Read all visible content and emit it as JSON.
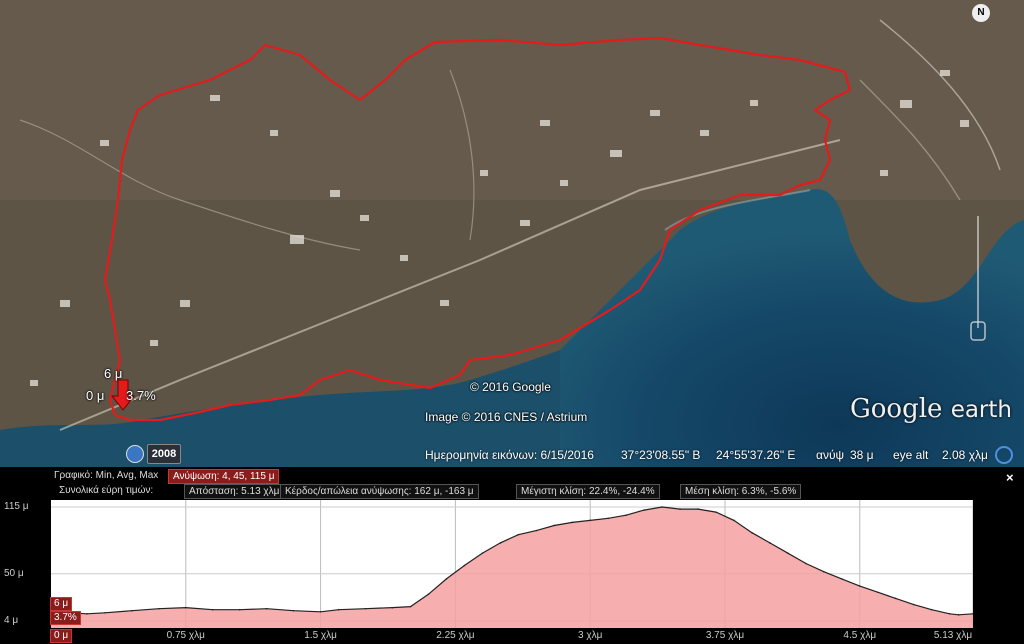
{
  "map": {
    "copyright_google": "© 2016 Google",
    "image_credit": "Image © 2016 CNES / Astrium",
    "brand_google": "Google",
    "brand_earth": "earth",
    "north_label": "N",
    "year": "2008",
    "cursor_elevation": "6 μ",
    "cursor_distance": "0 μ",
    "cursor_slope": "3.7%",
    "route_color": "#e41b1b"
  },
  "status": {
    "imagery_date": "Ημερομηνία εικόνων: 6/15/2016",
    "latitude": "37°23'08.55\" B",
    "longitude": "24°55'37.26\" E",
    "elev_label": "ανύψ",
    "elevation": "38 μ",
    "eye_alt_label": "eye alt",
    "eye_alt": "2.08 χλμ"
  },
  "profile": {
    "row1_label": "Γραφικό: Min, Avg, Max",
    "row1_value": "Ανύψωση: 4, 45, 115 μ",
    "row2_label": "Συνολικά εύρη τιμών:",
    "distance": "Απόσταση: 5.13 χλμ",
    "gain_loss": "Κέρδος/απώλεια ανύψωσης: 162 μ, -163 μ",
    "max_slope": "Μέγιστη κλίση: 22.4%, -24.4%",
    "avg_slope": "Μέση κλίση: 6.3%, -5.6%",
    "close": "×",
    "marker_elev": "6 μ",
    "marker_slope": "3.7%",
    "marker_dist": "0 μ"
  },
  "chart_data": {
    "type": "area",
    "title": "",
    "xlabel": "",
    "ylabel": "",
    "xlim": [
      0,
      5.13
    ],
    "ylim": [
      4,
      115
    ],
    "y_tick_labels": [
      "115 μ",
      "50 μ",
      "4 μ"
    ],
    "y_ticks": [
      115,
      50,
      4
    ],
    "x_tick_labels": [
      "0 μ",
      "0.75 χλμ",
      "1.5 χλμ",
      "2.25 χλμ",
      "3 χλμ",
      "3.75 χλμ",
      "4.5 χλμ",
      "5.13 χλμ"
    ],
    "x_ticks": [
      0,
      0.75,
      1.5,
      2.25,
      3,
      3.75,
      4.5,
      5.13
    ],
    "grid": true,
    "fill_color": "#f4a0a0",
    "line_color": "#222222",
    "series": [
      {
        "x": [
          0,
          0.1,
          0.2,
          0.3,
          0.45,
          0.6,
          0.75,
          0.9,
          1.05,
          1.2,
          1.35,
          1.5,
          1.6,
          1.75,
          1.9,
          2.0,
          2.1,
          2.2,
          2.3,
          2.4,
          2.5,
          2.6,
          2.7,
          2.8,
          2.9,
          3.0,
          3.1,
          3.2,
          3.3,
          3.4,
          3.5,
          3.6,
          3.7,
          3.8,
          3.9,
          4.0,
          4.1,
          4.2,
          4.3,
          4.4,
          4.5,
          4.6,
          4.7,
          4.8,
          4.9,
          5.0,
          5.05,
          5.13
        ],
        "y": [
          10,
          12,
          11,
          12,
          14,
          16,
          17,
          15,
          15,
          16,
          14,
          13,
          15,
          16,
          17,
          18,
          30,
          45,
          58,
          70,
          80,
          88,
          92,
          97,
          100,
          102,
          104,
          107,
          112,
          115,
          113,
          113,
          110,
          102,
          90,
          80,
          70,
          60,
          52,
          45,
          38,
          32,
          26,
          20,
          15,
          11,
          10,
          11
        ]
      }
    ]
  }
}
